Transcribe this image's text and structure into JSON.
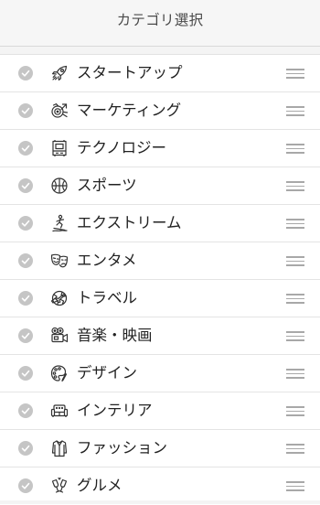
{
  "header": {
    "title": "カテゴリ選択"
  },
  "categories": [
    {
      "label": "スタートアップ",
      "icon": "rocket-icon",
      "selected": true
    },
    {
      "label": "マーケティング",
      "icon": "marketing-icon",
      "selected": true
    },
    {
      "label": "テクノロジー",
      "icon": "technology-icon",
      "selected": true
    },
    {
      "label": "スポーツ",
      "icon": "sports-ball-icon",
      "selected": true
    },
    {
      "label": "エクストリーム",
      "icon": "extreme-icon",
      "selected": true
    },
    {
      "label": "エンタメ",
      "icon": "theater-masks-icon",
      "selected": true
    },
    {
      "label": "トラベル",
      "icon": "travel-globe-icon",
      "selected": true
    },
    {
      "label": "音楽・映画",
      "icon": "movie-camera-icon",
      "selected": true
    },
    {
      "label": "デザイン",
      "icon": "palette-icon",
      "selected": true
    },
    {
      "label": "インテリア",
      "icon": "sofa-icon",
      "selected": true
    },
    {
      "label": "ファッション",
      "icon": "shirt-icon",
      "selected": true
    },
    {
      "label": "グルメ",
      "icon": "wine-glasses-icon",
      "selected": true
    }
  ],
  "colors": {
    "check_fill": "#c5c5c5",
    "icon_stroke": "#333333",
    "handle": "#a8a8a8",
    "background": "#f4f4f4"
  }
}
